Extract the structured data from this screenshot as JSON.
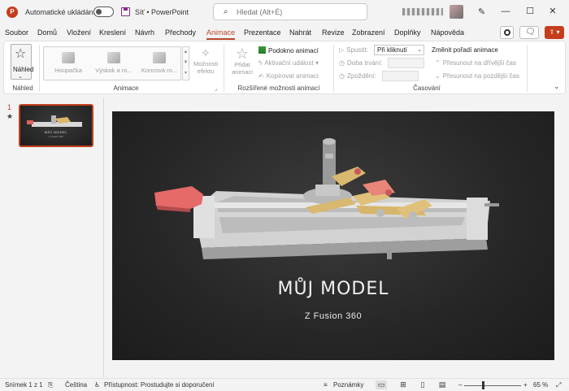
{
  "titlebar": {
    "logo_letter": "P",
    "autosave_label": "Automatické ukládání",
    "doc_title": "Síť • PowerPoint",
    "search_placeholder": "Hledat (Alt+É)",
    "minimize": "—",
    "maximize": "☐",
    "close": "✕"
  },
  "tabs": [
    {
      "label": "Soubor"
    },
    {
      "label": "Domů"
    },
    {
      "label": "Vložení"
    },
    {
      "label": "Kreslení"
    },
    {
      "label": "Návrh"
    },
    {
      "label": "Přechody"
    },
    {
      "label": "Animace"
    },
    {
      "label": "Prezentace"
    },
    {
      "label": "Nahrát"
    },
    {
      "label": "Revize"
    },
    {
      "label": "Zobrazení"
    },
    {
      "label": "Doplňky"
    },
    {
      "label": "Nápověda"
    }
  ],
  "active_tab": "Animace",
  "ribbon": {
    "preview": {
      "label": "Náhled",
      "group": "Náhled"
    },
    "animations": {
      "items": [
        "Houpačka",
        "Výskok a ro...",
        "Koncová ro..."
      ],
      "effect_options": [
        "Možnosti",
        "efektu"
      ],
      "group": "Animace"
    },
    "advanced": {
      "add_animation": [
        "Přidat",
        "animaci"
      ],
      "animation_pane": "Podokno animací",
      "trigger": "Aktivační událost",
      "animation_painter": "Kopírovat animaci",
      "group": "Rozšířené možnosti animací"
    },
    "timing": {
      "start_label": "Spustit:",
      "start_value": "Při kliknutí",
      "duration_label": "Doba trvání:",
      "delay_label": "Zpoždění:",
      "group": "Časování"
    },
    "reorder": {
      "title": "Změnit pořadí animace",
      "move_earlier": "Přesunout na dřívější čas",
      "move_later": "Přesunout na pozdější čas"
    }
  },
  "thumbnails": [
    {
      "number": "1",
      "title": "MŮJ MODEL",
      "subtitle": "Z Fusion 360"
    }
  ],
  "slide": {
    "title": "MŮJ MODEL",
    "subtitle": "Z Fusion 360"
  },
  "statusbar": {
    "slide_info": "Snímek 1 z 1",
    "language": "Čeština",
    "accessibility": "Přístupnost: Prostudujte si doporučení",
    "notes": "Poznámky",
    "zoom_minus": "–",
    "zoom_plus": "+",
    "zoom": "65 %"
  },
  "colors": {
    "accent": "#b7472a",
    "brand": "#c43e1c"
  }
}
